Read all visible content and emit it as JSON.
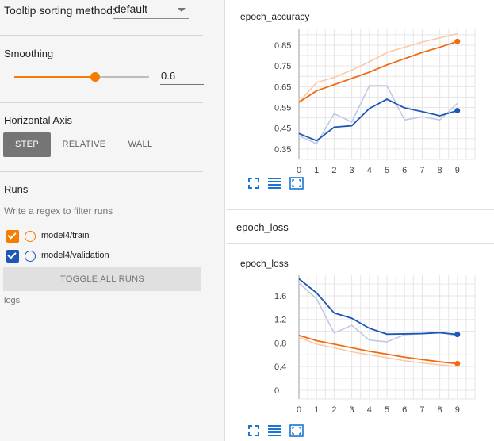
{
  "sidebar": {
    "tooltip_label": "Tooltip sorting method:",
    "tooltip_value": "default",
    "smoothing_title": "Smoothing",
    "smoothing_value": "0.6",
    "smoothing_fraction": 0.6,
    "horizontal_axis_title": "Horizontal Axis",
    "axis_buttons": [
      "STEP",
      "RELATIVE",
      "WALL"
    ],
    "axis_selected": "STEP",
    "runs_title": "Runs",
    "regex_placeholder": "Write a regex to filter runs",
    "runs": [
      {
        "label": "model4/train",
        "color": "#f57c00",
        "checked": true
      },
      {
        "label": "model4/validation",
        "color": "#1e57b5",
        "checked": true
      }
    ],
    "toggle_all_label": "TOGGLE ALL RUNS",
    "logs_label": "logs"
  },
  "colors": {
    "accent": "#f57c00",
    "train": "#f26b0f",
    "validation": "#1e57b5",
    "train_raw": "#f9c7a6",
    "validation_raw": "#bcc7e3"
  },
  "main": {
    "group_header": "epoch_loss",
    "tool_icons": [
      "fit-domain-icon",
      "data-table-icon",
      "expand-chart-icon"
    ]
  },
  "chart_data": [
    {
      "type": "line",
      "title": "epoch_accuracy",
      "x": [
        0,
        1,
        2,
        3,
        4,
        5,
        6,
        7,
        8,
        9
      ],
      "yticks": [
        0.35,
        0.45,
        0.55,
        0.65,
        0.75,
        0.85
      ],
      "ylim": [
        0.3,
        0.93
      ],
      "xlim": [
        0,
        10
      ],
      "grid": true,
      "series": [
        {
          "name": "model4/train",
          "color": "#f26b0f",
          "raw_color": "#f9c7a6",
          "raw": [
            0.575,
            0.67,
            0.695,
            0.73,
            0.77,
            0.815,
            0.84,
            0.865,
            0.885,
            0.905
          ],
          "smoothed": [
            0.575,
            0.63,
            0.66,
            0.69,
            0.72,
            0.755,
            0.785,
            0.815,
            0.84,
            0.868
          ]
        },
        {
          "name": "model4/validation",
          "color": "#1e57b5",
          "raw_color": "#bcc7e3",
          "raw": [
            0.415,
            0.375,
            0.52,
            0.48,
            0.655,
            0.655,
            0.49,
            0.505,
            0.49,
            0.57
          ],
          "smoothed": [
            0.425,
            0.39,
            0.455,
            0.462,
            0.545,
            0.59,
            0.548,
            0.53,
            0.51,
            0.535
          ]
        }
      ]
    },
    {
      "type": "line",
      "title": "epoch_loss",
      "x": [
        0,
        1,
        2,
        3,
        4,
        5,
        6,
        7,
        8,
        9
      ],
      "yticks": [
        0,
        0.4,
        0.8,
        1.2,
        1.6
      ],
      "ylim": [
        -0.15,
        1.95
      ],
      "xlim": [
        0,
        10
      ],
      "grid": true,
      "series": [
        {
          "name": "model4/train",
          "color": "#f26b0f",
          "raw_color": "#f9c7a6",
          "raw": [
            0.9,
            0.78,
            0.72,
            0.65,
            0.6,
            0.55,
            0.5,
            0.46,
            0.43,
            0.4
          ],
          "smoothed": [
            0.93,
            0.84,
            0.78,
            0.72,
            0.66,
            0.61,
            0.56,
            0.52,
            0.48,
            0.45
          ]
        },
        {
          "name": "model4/validation",
          "color": "#1e57b5",
          "raw_color": "#bcc7e3",
          "raw": [
            1.82,
            1.55,
            0.97,
            1.1,
            0.85,
            0.82,
            0.94,
            0.96,
            0.98,
            0.92
          ],
          "smoothed": [
            1.89,
            1.65,
            1.31,
            1.22,
            1.05,
            0.95,
            0.955,
            0.96,
            0.975,
            0.945
          ]
        }
      ]
    }
  ]
}
